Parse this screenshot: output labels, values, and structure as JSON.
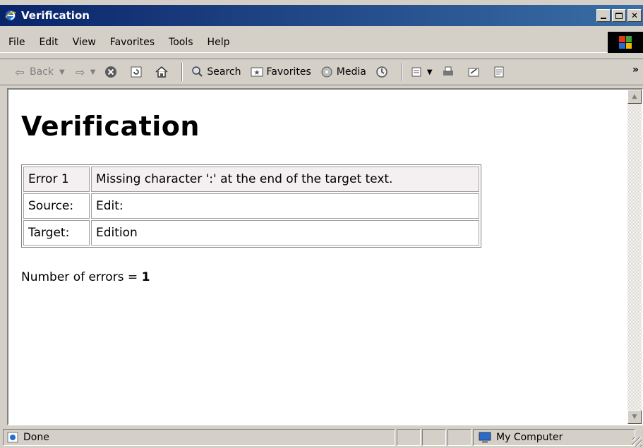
{
  "window": {
    "title": "Verification"
  },
  "menu": [
    "File",
    "Edit",
    "View",
    "Favorites",
    "Tools",
    "Help"
  ],
  "toolbar": {
    "back": "Back",
    "search": "Search",
    "favorites": "Favorites",
    "media": "Media",
    "more": "»"
  },
  "page": {
    "heading": "Verification",
    "table": [
      {
        "label": "Error 1",
        "value": "Missing character ':' at the end of the target text."
      },
      {
        "label": "Source:",
        "value": "Edit:"
      },
      {
        "label": "Target:",
        "value": "Edition"
      }
    ],
    "summary_prefix": "Number of errors = ",
    "error_count": "1"
  },
  "status": {
    "text": "Done",
    "zone": "My Computer"
  }
}
